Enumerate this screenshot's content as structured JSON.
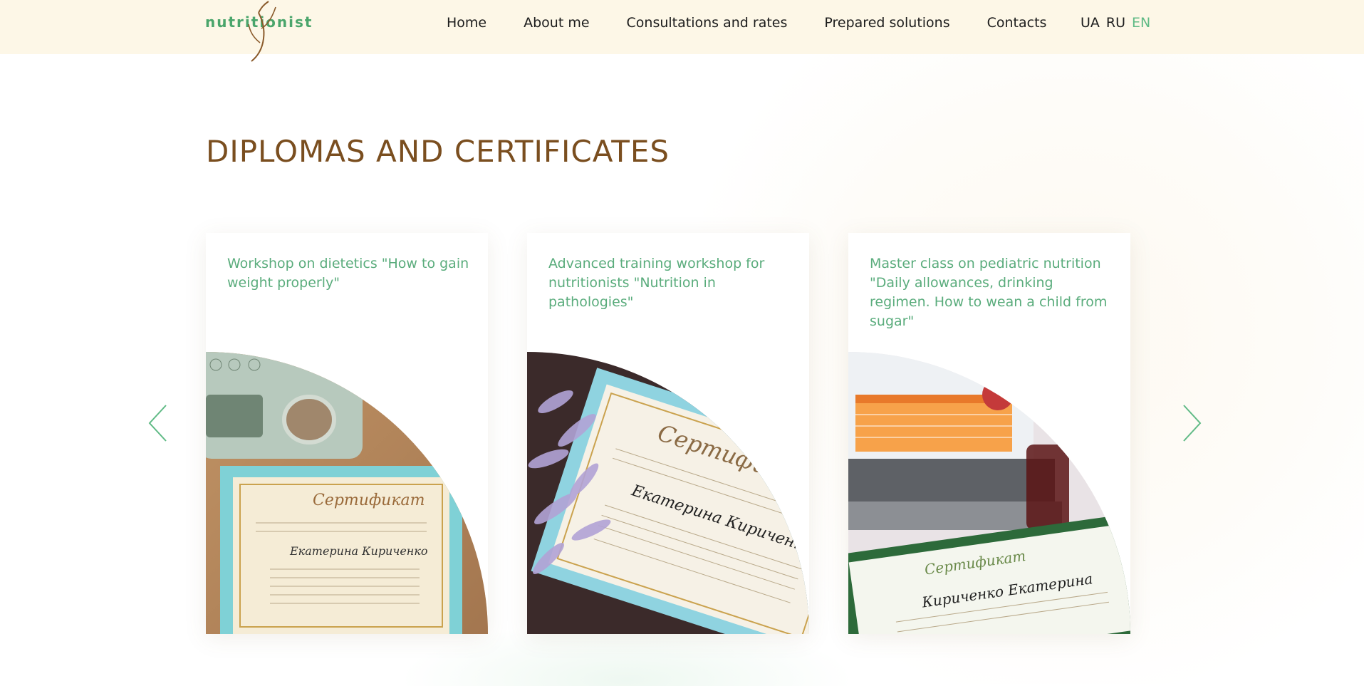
{
  "header": {
    "logo_text": "nutritionist",
    "nav": [
      {
        "label": "Home"
      },
      {
        "label": "About me"
      },
      {
        "label": "Consultations and rates"
      },
      {
        "label": "Prepared solutions"
      },
      {
        "label": "Contacts"
      }
    ],
    "languages": [
      {
        "label": "UA",
        "active": false
      },
      {
        "label": "RU",
        "active": false
      },
      {
        "label": "EN",
        "active": true
      }
    ]
  },
  "section": {
    "title": "DIPLOMAS AND CERTIFICATES"
  },
  "carousel": {
    "prev_icon": "chevron-left-icon",
    "next_icon": "chevron-right-icon",
    "cards": [
      {
        "title": "Workshop on dietetics \"How to gain weight properly\""
      },
      {
        "title": "Advanced training workshop for nutritionists \"Nutrition in pathologies\""
      },
      {
        "title": "Master class on pediatric nutrition \"Daily allowances, drinking regimen. How to wean a child from sugar\""
      }
    ]
  },
  "colors": {
    "header_bg": "#fdf7e7",
    "accent_green": "#5fba85",
    "title_brown": "#7a4e1f",
    "card_title_green": "#5aac7c"
  }
}
